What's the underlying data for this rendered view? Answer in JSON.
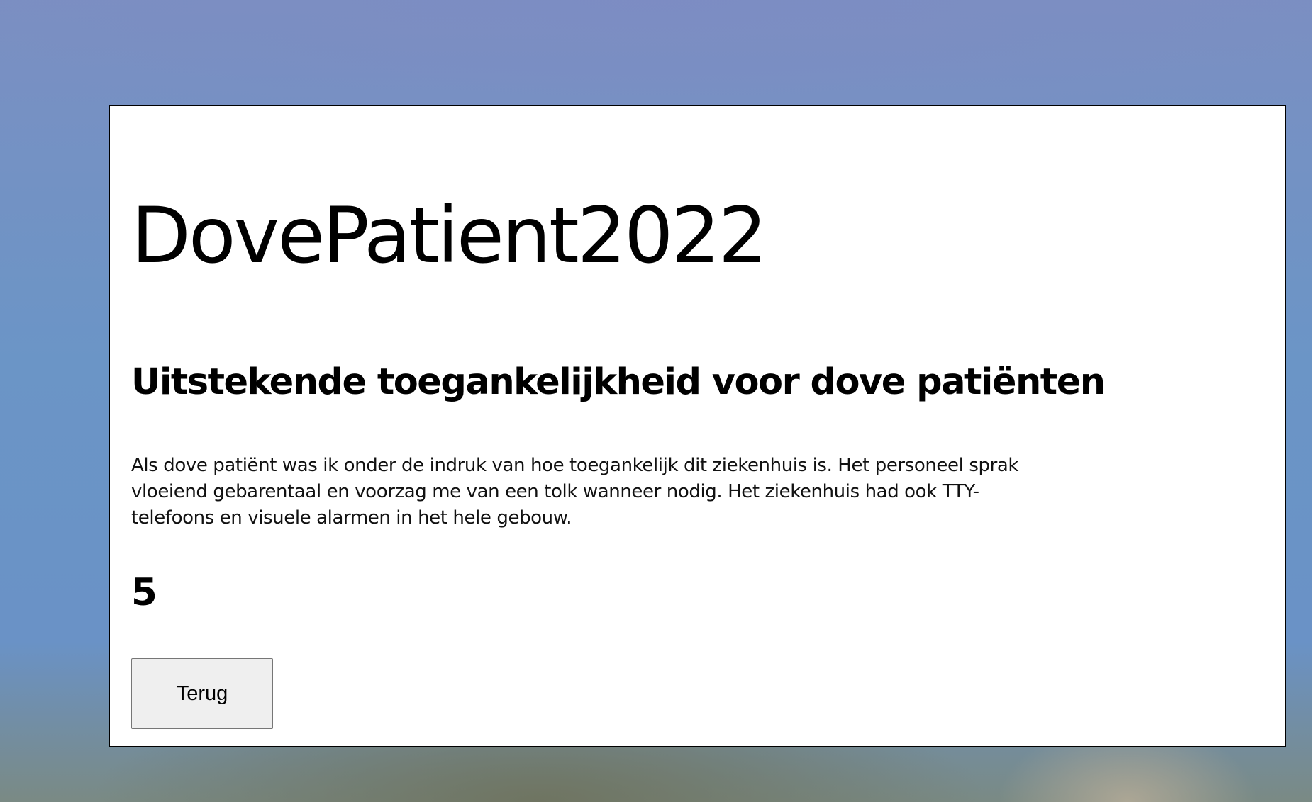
{
  "review": {
    "username": "DovePatient2022",
    "title": "Uitstekende toegankelijkheid voor dove patiënten",
    "text": "Als dove patiënt was ik onder de indruk van hoe toegankelijk dit ziekenhuis is. Het personeel sprak vloeiend gebarentaal en voorzag me van een tolk wanneer nodig. Het ziekenhuis had ook TTY-telefoons en visuele alarmen in het hele gebouw.",
    "rating": "5"
  },
  "actions": {
    "back_label": "Terug"
  },
  "colors": {
    "card_background": "#ffffff",
    "card_border": "#000000",
    "button_background": "#efefef"
  }
}
